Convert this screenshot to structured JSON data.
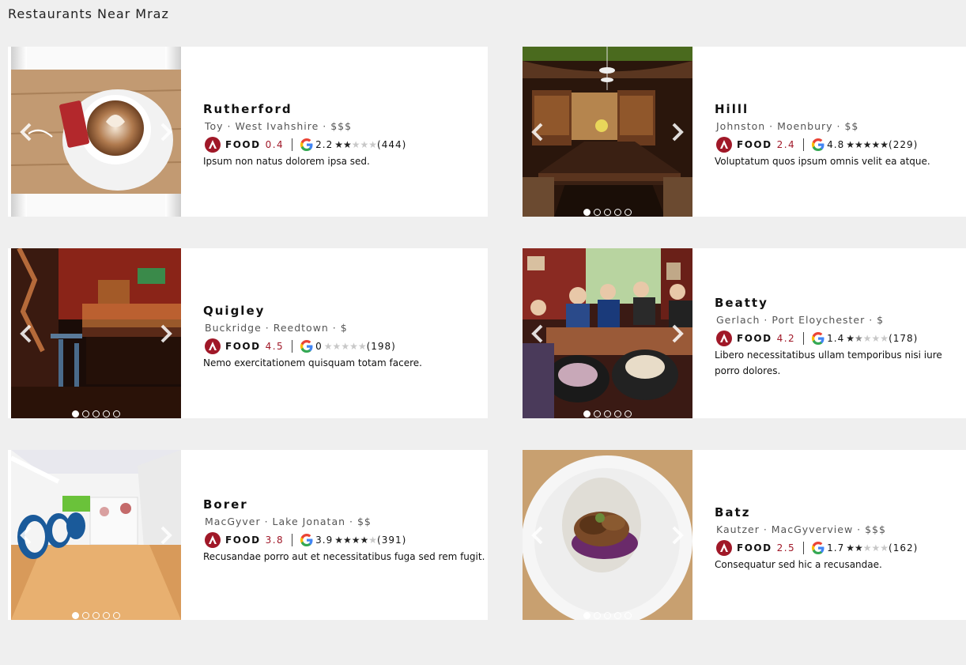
{
  "page": {
    "title": "Restaurants Near Mraz"
  },
  "colors": {
    "brand_red": "#a01828",
    "background": "#efefef"
  },
  "food_label": "FOOD",
  "restaurants": [
    {
      "name": "Rutherford",
      "meta": "Toy · West Ivahshire · $$$",
      "food_score": "0.4",
      "google_score": "2.2",
      "google_stars": 2,
      "count": "(444)",
      "description": "Ipsum non natus dolorem ipsa sed.",
      "photo": "latte-art-on-wooden-table",
      "dots": 0,
      "active_dot": 0
    },
    {
      "name": "Hilll",
      "meta": "Johnston · Moenbury · $$",
      "food_score": "2.4",
      "google_score": "4.8",
      "google_stars": 5,
      "count": "(229)",
      "description": "Voluptatum quos ipsum omnis velit ea atque.",
      "photo": "bar-dining-room",
      "dots": 5,
      "active_dot": 0
    },
    {
      "name": "Quigley",
      "meta": "Buckridge · Reedtown · $",
      "food_score": "4.5",
      "google_score": "0",
      "google_stars": 0,
      "count": "(198)",
      "description": "Nemo exercitationem quisquam totam facere.",
      "photo": "dark-bar-counter",
      "dots": 5,
      "active_dot": 0
    },
    {
      "name": "Beatty",
      "meta": "Gerlach · Port Eloychester · $",
      "food_score": "4.2",
      "google_score": "1.4",
      "google_stars": 1.5,
      "count": "(178)",
      "description": "Libero necessitatibus ullam temporibus nisi iure porro dolores.",
      "photo": "group-dinner-table",
      "dots": 5,
      "active_dot": 0
    },
    {
      "name": "Borer",
      "meta": "MacGyver · Lake Jonatan · $$",
      "food_score": "3.8",
      "google_score": "3.9",
      "google_stars": 4,
      "count": "(391)",
      "description": "Recusandae porro aut et necessitatibus fuga sed rem fugit.",
      "photo": "gallery-with-egg-chairs",
      "dots": 5,
      "active_dot": 0
    },
    {
      "name": "Batz",
      "meta": "Kautzer · MacGyverview · $$$",
      "food_score": "2.5",
      "google_score": "1.7",
      "google_stars": 2,
      "count": "(162)",
      "description": "Consequatur sed hic a recusandae.",
      "photo": "plated-dish",
      "dots": 5,
      "active_dot": 0
    }
  ]
}
